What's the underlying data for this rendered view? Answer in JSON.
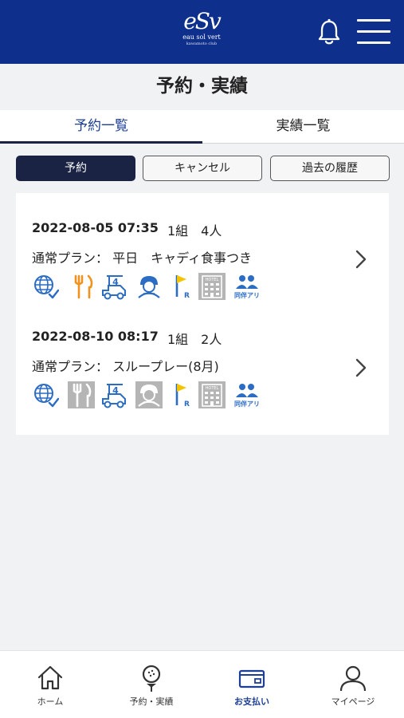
{
  "header": {
    "logo_mark": "eSv",
    "logo_name": "eau sol vert",
    "logo_sub": "kawamoto club"
  },
  "page_title": "予約・実績",
  "tabs": [
    {
      "label": "予約一覧",
      "active": true
    },
    {
      "label": "実績一覧",
      "active": false
    }
  ],
  "filters": [
    {
      "label": "予約",
      "active": true
    },
    {
      "label": "キャンセル",
      "active": false
    },
    {
      "label": "過去の履歴",
      "active": false
    }
  ],
  "reservations": [
    {
      "datetime": "2022-08-05 07:35",
      "meta": "1組　4人",
      "plan": "通常プラン： 平日　キャディ食事つき",
      "icons": [
        {
          "name": "web-booking-icon",
          "enabled": true
        },
        {
          "name": "meal-icon",
          "enabled": true
        },
        {
          "name": "four-seat-cart-icon",
          "enabled": true
        },
        {
          "name": "caddie-icon",
          "enabled": true
        },
        {
          "name": "regular-tee-icon",
          "enabled": true
        },
        {
          "name": "hotel-icon",
          "enabled": false
        },
        {
          "name": "companion-icon",
          "enabled": true
        }
      ]
    },
    {
      "datetime": "2022-08-10 08:17",
      "meta": "1組　2人",
      "plan": "通常プラン： スループレー(8月)",
      "icons": [
        {
          "name": "web-booking-icon",
          "enabled": true
        },
        {
          "name": "meal-icon",
          "enabled": false
        },
        {
          "name": "four-seat-cart-icon",
          "enabled": true
        },
        {
          "name": "caddie-icon",
          "enabled": false
        },
        {
          "name": "regular-tee-icon",
          "enabled": true
        },
        {
          "name": "hotel-icon",
          "enabled": false
        },
        {
          "name": "companion-icon",
          "enabled": true
        }
      ]
    }
  ],
  "icon_text": {
    "tee_r": "R",
    "hotel": "HOTEL",
    "companion": "同伴アリ"
  },
  "bottom_nav": [
    {
      "label": "ホーム",
      "icon": "home-icon",
      "active": false
    },
    {
      "label": "予約・実績",
      "icon": "golf-ball-tee-icon",
      "active": false
    },
    {
      "label": "お支払い",
      "icon": "card-icon",
      "active": true
    },
    {
      "label": "マイページ",
      "icon": "person-icon",
      "active": false
    }
  ],
  "colors": {
    "brand": "#0e2f8c",
    "accent": "#2b6cc4",
    "active_tab": "#1c3f94",
    "dark_button": "#1b2344",
    "meal_orange": "#f0931e",
    "tee_yellow": "#f4c400",
    "disabled_bg": "#b5b5b5"
  }
}
